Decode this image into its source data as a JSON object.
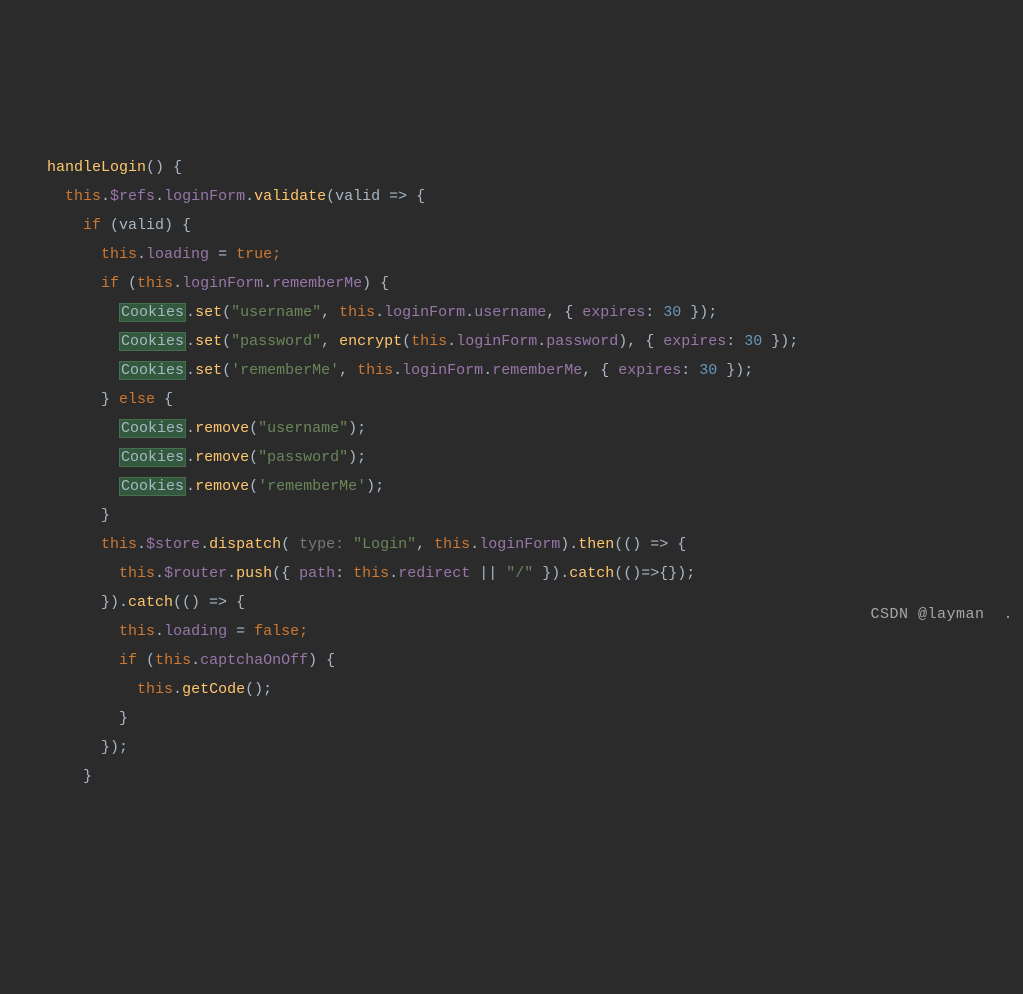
{
  "watermark": "CSDN @layman  .",
  "code": {
    "l1_fn": "handleLogin",
    "l1_suffix": "() {",
    "l2_this": "this",
    "l2_refs": "$refs",
    "l2_loginForm": "loginForm",
    "l2_validate": "validate",
    "l2_param": "valid",
    "l2_arrow": " => {",
    "l3_if": "if",
    "l3_cond": " (valid) {",
    "l4_this": "this",
    "l4_loading": "loading",
    "l4_eq": " = ",
    "l4_true": "true",
    "l4_semi": ";",
    "l5_if": "if",
    "l5_open": " (",
    "l5_this": "this",
    "l5_loginForm": "loginForm",
    "l5_remember": "rememberMe",
    "l5_close": ") {",
    "l6_cookies": "Cookies",
    "l6_set": "set",
    "l6_str_username": "\"username\"",
    "l6_this": "this",
    "l6_loginForm": "loginForm",
    "l6_username": "username",
    "l6_expires": "expires",
    "l6_num": "30",
    "l7_cookies": "Cookies",
    "l7_set": "set",
    "l7_str_password": "\"password\"",
    "l7_encrypt": "encrypt",
    "l7_this": "this",
    "l7_loginForm": "loginForm",
    "l7_password": "password",
    "l7_expires": "expires",
    "l7_num": "30",
    "l8_cookies": "Cookies",
    "l8_set": "set",
    "l8_str_remember": "'rememberMe'",
    "l8_this": "this",
    "l8_loginForm": "loginForm",
    "l8_remember": "rememberMe",
    "l8_expires": "expires",
    "l8_num": "30",
    "l9_close": "} ",
    "l9_else": "else",
    "l9_open": " {",
    "l10_cookies": "Cookies",
    "l10_remove": "remove",
    "l10_str": "\"username\"",
    "l11_cookies": "Cookies",
    "l11_remove": "remove",
    "l11_str": "\"password\"",
    "l12_cookies": "Cookies",
    "l12_remove": "remove",
    "l12_str": "'rememberMe'",
    "l13_close": "}",
    "l14_this": "this",
    "l14_store": "$store",
    "l14_dispatch": "dispatch",
    "l14_hint": " type: ",
    "l14_str_login": "\"Login\"",
    "l14_this2": "this",
    "l14_loginForm": "loginForm",
    "l14_then": "then",
    "l14_arrow": " => {",
    "l15_this": "this",
    "l15_router": "$router",
    "l15_push": "push",
    "l15_path": "path",
    "l15_this2": "this",
    "l15_redirect": "redirect",
    "l15_or": " || ",
    "l15_slash": "\"/\"",
    "l15_catch": "catch",
    "l15_arrow": "(()=>{});",
    "l16_close": "}).",
    "l16_catch": "catch",
    "l16_arrow": "(() => {",
    "l17_this": "this",
    "l17_loading": "loading",
    "l17_eq": " = ",
    "l17_false": "false",
    "l17_semi": ";",
    "l18_if": "if",
    "l18_open": " (",
    "l18_this": "this",
    "l18_captcha": "captchaOnOff",
    "l18_close": ") {",
    "l19_this": "this",
    "l19_getcode": "getCode",
    "l19_end": "();",
    "l20_close": "}",
    "l21_close": "});",
    "l22_close": "}"
  }
}
